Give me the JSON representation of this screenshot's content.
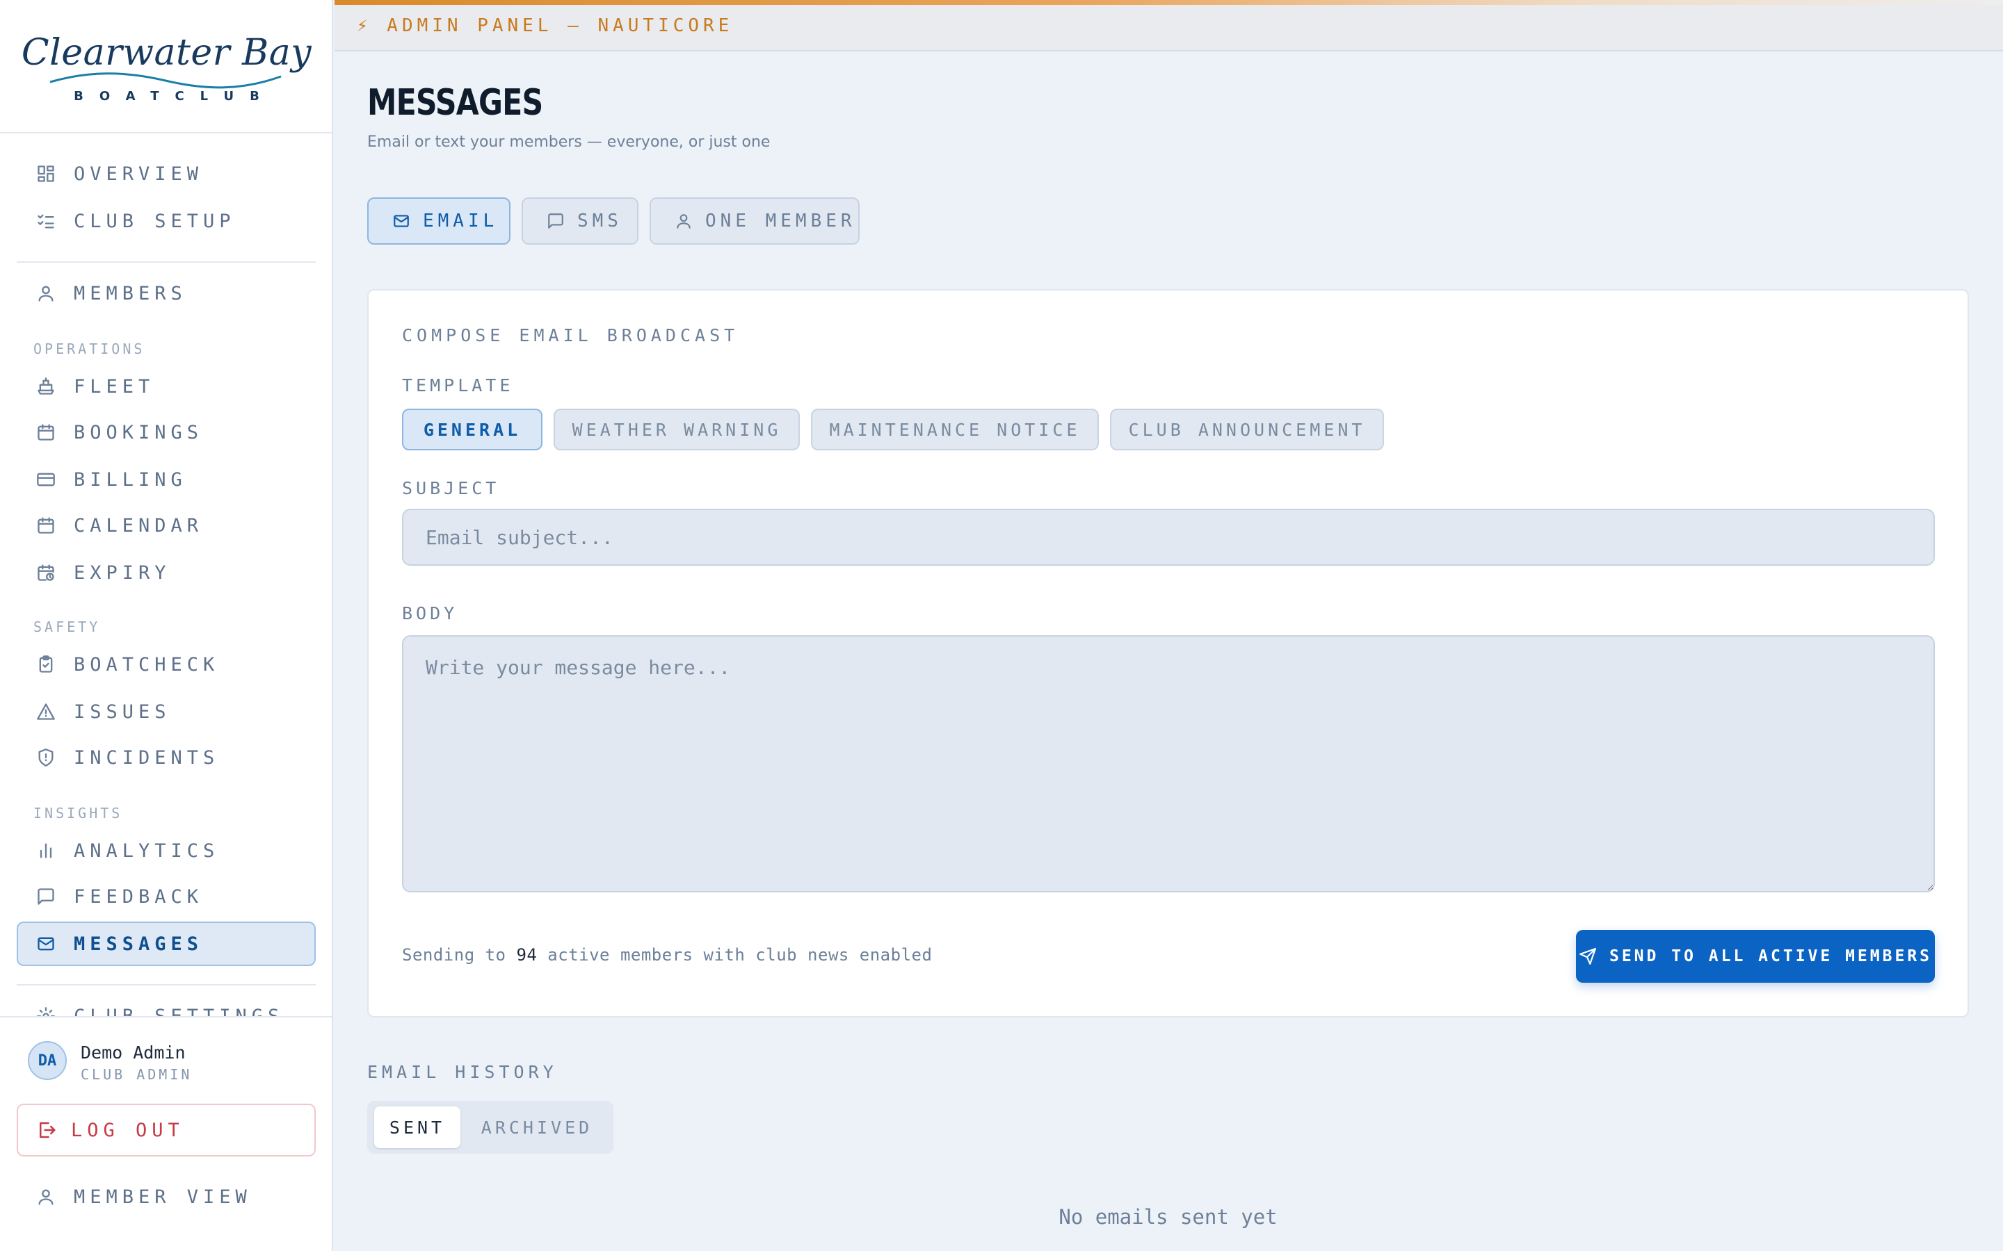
{
  "brand": {
    "name": "Clearwater Bay",
    "sub": "BOATCLUB"
  },
  "topbar": {
    "text": "⚡  ADMIN PANEL — NAUTICORE"
  },
  "sidebar": {
    "items": [
      {
        "label": "OVERVIEW",
        "icon": "dashboard-icon"
      },
      {
        "label": "CLUB SETUP",
        "icon": "checklist-icon"
      },
      {
        "label": "MEMBERS",
        "icon": "user-icon"
      },
      {
        "label": "FLEET",
        "icon": "ship-icon"
      },
      {
        "label": "BOOKINGS",
        "icon": "calendar-icon"
      },
      {
        "label": "BILLING",
        "icon": "credit-card-icon"
      },
      {
        "label": "CALENDAR",
        "icon": "calendar-icon"
      },
      {
        "label": "EXPIRY",
        "icon": "calendar-clock-icon"
      },
      {
        "label": "BOATCHECK",
        "icon": "clipboard-check-icon"
      },
      {
        "label": "ISSUES",
        "icon": "warning-icon"
      },
      {
        "label": "INCIDENTS",
        "icon": "shield-alert-icon"
      },
      {
        "label": "ANALYTICS",
        "icon": "bar-chart-icon"
      },
      {
        "label": "FEEDBACK",
        "icon": "message-square-icon"
      },
      {
        "label": "MESSAGES",
        "icon": "mail-icon"
      },
      {
        "label": "CLUB SETTINGS",
        "icon": "gear-icon"
      }
    ],
    "sections": {
      "operations": "OPERATIONS",
      "safety": "SAFETY",
      "insights": "INSIGHTS"
    },
    "active_item": "MESSAGES"
  },
  "user": {
    "initials": "DA",
    "name": "Demo Admin",
    "role": "CLUB ADMIN"
  },
  "footer": {
    "logout_label": "LOG OUT",
    "member_view_label": "MEMBER VIEW"
  },
  "page": {
    "title": "MESSAGES",
    "subtitle": "Email or text your members — everyone, or just one"
  },
  "tabs": [
    {
      "label": "EMAIL",
      "active": true
    },
    {
      "label": "SMS",
      "active": false
    },
    {
      "label": "ONE MEMBER",
      "active": false
    }
  ],
  "compose": {
    "title": "COMPOSE EMAIL BROADCAST",
    "template_label": "TEMPLATE",
    "templates": [
      {
        "label": "GENERAL",
        "active": true
      },
      {
        "label": "WEATHER WARNING",
        "active": false
      },
      {
        "label": "MAINTENANCE NOTICE",
        "active": false
      },
      {
        "label": "CLUB ANNOUNCEMENT",
        "active": false
      }
    ],
    "subject_label": "SUBJECT",
    "subject_placeholder": "Email subject...",
    "subject_value": "",
    "body_label": "BODY",
    "body_placeholder": "Write your message here...",
    "body_value": "",
    "send_note_prefix": "Sending to ",
    "send_count": "94",
    "send_note_suffix": " active members with club news enabled",
    "send_button": "SEND TO ALL ACTIVE MEMBERS"
  },
  "history": {
    "title": "EMAIL HISTORY",
    "segments": [
      {
        "label": "SENT",
        "active": true
      },
      {
        "label": "ARCHIVED",
        "active": false
      }
    ],
    "empty_text": "No emails sent yet"
  },
  "colors": {
    "accent": "#0b63c4",
    "topbar_accent": "#d98a2b",
    "danger": "#c63b45",
    "background": "#edf2f8"
  }
}
